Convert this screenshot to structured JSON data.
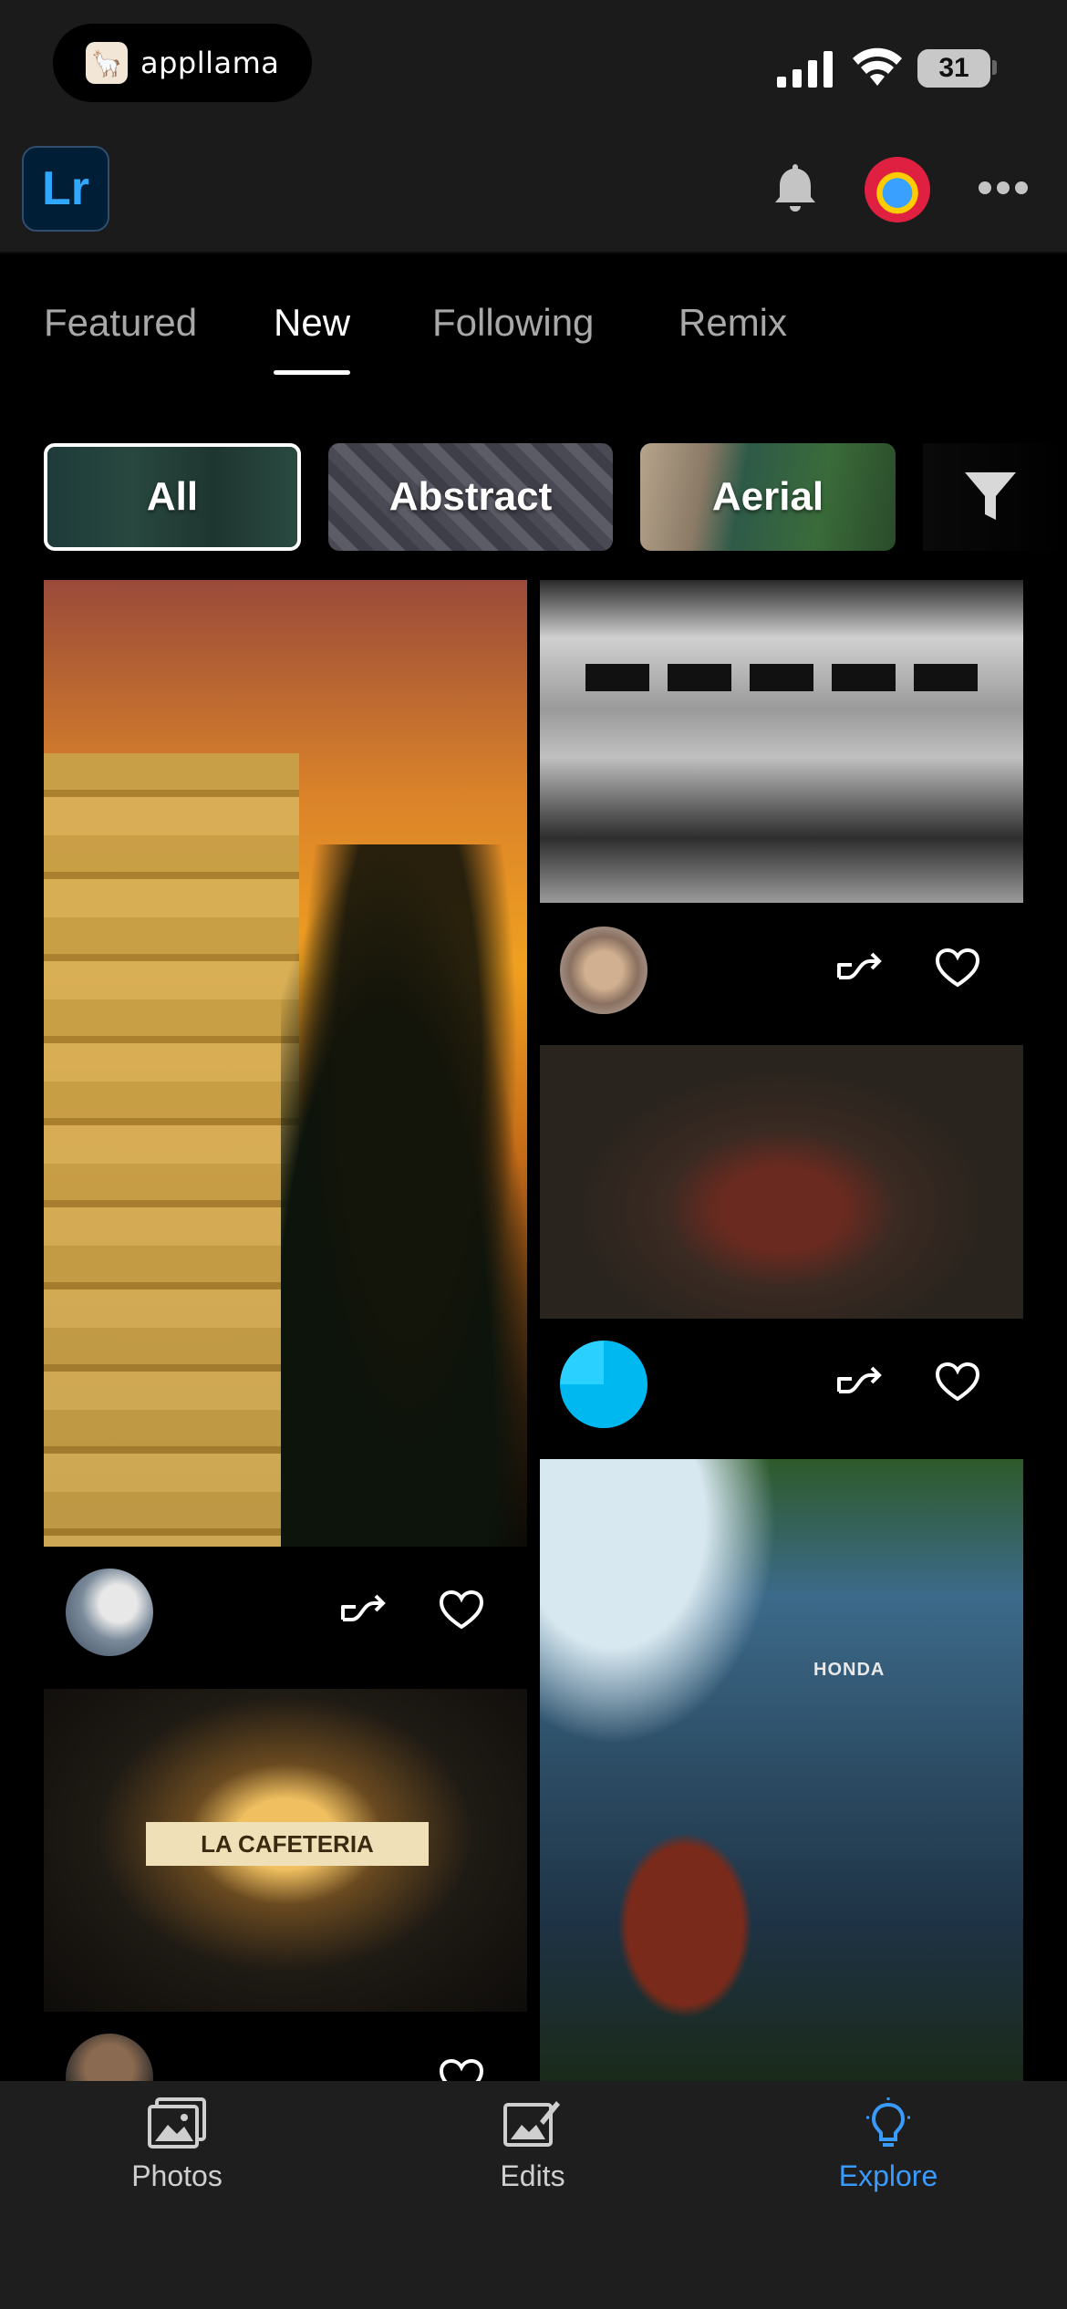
{
  "status_bar": {
    "app_badge": "appllama",
    "battery": "31"
  },
  "header": {
    "app_logo": "Lr"
  },
  "tabs": [
    {
      "label": "Featured"
    },
    {
      "label": "New"
    },
    {
      "label": "Following"
    },
    {
      "label": "Remix"
    }
  ],
  "categories": [
    {
      "label": "All"
    },
    {
      "label": "Abstract"
    },
    {
      "label": "Aerial"
    }
  ],
  "cafe_sign": "LA CAFETERIA",
  "atv_brand": "HONDA",
  "bottom_nav": [
    {
      "label": "Photos"
    },
    {
      "label": "Edits"
    },
    {
      "label": "Explore"
    }
  ],
  "colors": {
    "accent": "#3a9bff",
    "lr_logo_bg": "#001e36",
    "lr_logo_text": "#31a8ff"
  }
}
